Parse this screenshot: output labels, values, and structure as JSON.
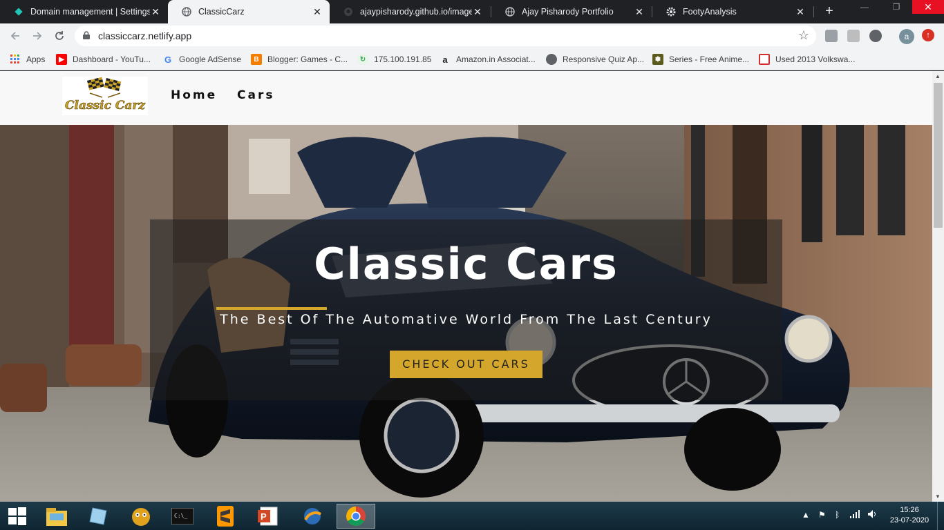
{
  "browser": {
    "tabs": [
      {
        "label": "Domain management | Settings",
        "icon": "netlify-diamond-icon",
        "active": false
      },
      {
        "label": "ClassicCarz",
        "icon": "globe-icon",
        "active": true
      },
      {
        "label": "ajaypisharody.github.io/images",
        "icon": "github-icon",
        "active": false
      },
      {
        "label": "Ajay Pisharody Portfolio",
        "icon": "globe-icon",
        "active": false
      },
      {
        "label": "FootyAnalysis",
        "icon": "gear-icon",
        "active": false
      }
    ],
    "close_glyph": "✕",
    "new_tab_glyph": "+",
    "url": "classiccarz.netlify.app",
    "avatar_letter": "a",
    "update_glyph": "↑",
    "bookmarks": [
      {
        "label": "Apps",
        "icon": "apps-grid-icon"
      },
      {
        "label": "Dashboard - YouTu...",
        "icon": "youtube-icon",
        "color": "#ff0000"
      },
      {
        "label": "Google AdSense",
        "icon": "google-icon",
        "color": "#4285f4"
      },
      {
        "label": "Blogger: Games - C...",
        "icon": "blogger-icon",
        "color": "#f57d00"
      },
      {
        "label": "175.100.191.85",
        "icon": "refresh-globe-icon",
        "color": "#34a853"
      },
      {
        "label": "Amazon.in Associat...",
        "icon": "amazon-icon",
        "color": "#222222"
      },
      {
        "label": "Responsive Quiz Ap...",
        "icon": "globe-icon",
        "color": "#5f6368"
      },
      {
        "label": "Series - Free Anime...",
        "icon": "paw-icon",
        "color": "#5b5b1e"
      },
      {
        "label": "Used 2013 Volkswa...",
        "icon": "car-site-icon",
        "color": "#d32f2f"
      }
    ]
  },
  "site": {
    "logo_text": "Classic Carz",
    "nav": [
      {
        "label": "Home"
      },
      {
        "label": "Cars"
      }
    ],
    "hero": {
      "title": "Classic Cars",
      "subtitle": "The Best Of The Automative World From The Last Century",
      "cta_label": "CHECK OUT CARS"
    },
    "colors": {
      "accent": "#d4a72c",
      "nav_bg": "#f8f8f8"
    }
  },
  "taskbar": {
    "apps": [
      {
        "icon": "windows-start-icon"
      },
      {
        "icon": "file-explorer-icon"
      },
      {
        "icon": "notepad-icon"
      },
      {
        "icon": "folder-monkey-icon"
      },
      {
        "icon": "command-prompt-icon"
      },
      {
        "icon": "sublime-text-icon"
      },
      {
        "icon": "powerpoint-icon"
      },
      {
        "icon": "browser-alt-icon"
      },
      {
        "icon": "chrome-icon",
        "active": true
      }
    ],
    "time": "15:26",
    "date": "23-07-2020"
  }
}
